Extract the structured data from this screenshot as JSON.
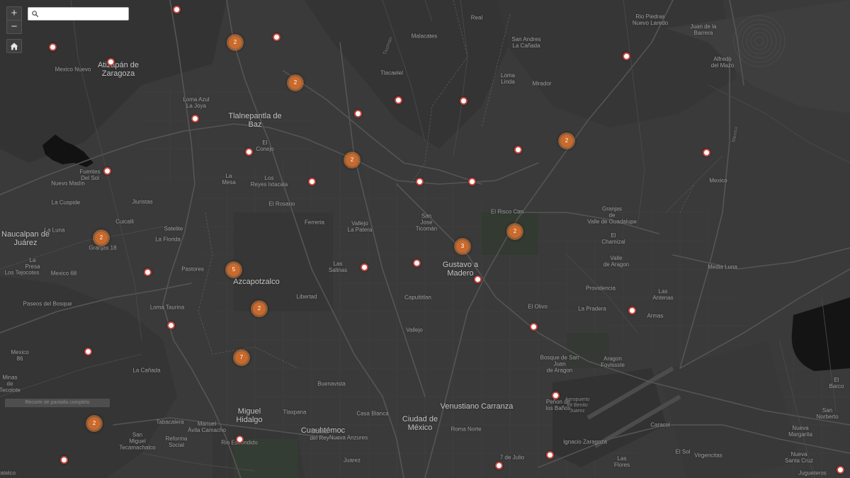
{
  "search": {
    "placeholder": ""
  },
  "zoom": {
    "in_label": "+",
    "out_label": "−"
  },
  "fullscreen_label": "Recorte de pantalla completo",
  "icons": {
    "zoom_in": "plus-icon",
    "zoom_out": "minus-icon",
    "home": "home-icon",
    "search": "search-icon"
  },
  "colors": {
    "basemap": "#3a3a3a",
    "pin_border": "#c9463d",
    "cluster_fill": "#c96a2c"
  },
  "places": [
    {
      "name": "Atizapán de\nZaragoza",
      "cls": "major"
    },
    {
      "name": "Mexico Nuevo",
      "cls": ""
    },
    {
      "name": "Tlalnepantla de\nBaz",
      "cls": "major"
    },
    {
      "name": "Naucalpan de\nJuárez",
      "cls": "major"
    },
    {
      "name": "Azcapotzalco",
      "cls": "major"
    },
    {
      "name": "Gustavo a\nMadero",
      "cls": "major"
    },
    {
      "name": "Miguel\nHidalgo",
      "cls": "major"
    },
    {
      "name": "Ciudad de\nMéxico",
      "cls": "major"
    },
    {
      "name": "Venustiano Carranza",
      "cls": "major"
    },
    {
      "name": "Cuauhtémoc",
      "cls": "major"
    },
    {
      "name": "Loma Azul\nLa Joya",
      "cls": ""
    },
    {
      "name": "El\nConejo",
      "cls": ""
    },
    {
      "name": "La\nMesa",
      "cls": ""
    },
    {
      "name": "Los\nReyes Ixtacala",
      "cls": ""
    },
    {
      "name": "El Rosario",
      "cls": ""
    },
    {
      "name": "Fuentes\nDel Sol",
      "cls": ""
    },
    {
      "name": "Nuevo Madín",
      "cls": ""
    },
    {
      "name": "La Cuspide",
      "cls": ""
    },
    {
      "name": "Jiuristas",
      "cls": ""
    },
    {
      "name": "Cuicalli",
      "cls": ""
    },
    {
      "name": "Satelite",
      "cls": ""
    },
    {
      "name": "La Florida",
      "cls": ""
    },
    {
      "name": "La Luna",
      "cls": ""
    },
    {
      "name": "Granjas 18",
      "cls": ""
    },
    {
      "name": "La\nPresa",
      "cls": ""
    },
    {
      "name": "Los Tejocotes",
      "cls": ""
    },
    {
      "name": "Mexico 68",
      "cls": ""
    },
    {
      "name": "Pastores",
      "cls": ""
    },
    {
      "name": "Paseos del Bosque",
      "cls": ""
    },
    {
      "name": "Loma Taurina",
      "cls": ""
    },
    {
      "name": "Mexico\n86",
      "cls": ""
    },
    {
      "name": "La Cañada",
      "cls": ""
    },
    {
      "name": "Minas\nde\nTecolote",
      "cls": ""
    },
    {
      "name": "Ferreria",
      "cls": ""
    },
    {
      "name": "Vallejo\nLa Patera",
      "cls": ""
    },
    {
      "name": "San\nJose\nTicomán",
      "cls": ""
    },
    {
      "name": "Las\nSalinas",
      "cls": ""
    },
    {
      "name": "Libertad",
      "cls": ""
    },
    {
      "name": "Capultitlan",
      "cls": ""
    },
    {
      "name": "Vallejo",
      "cls": ""
    },
    {
      "name": "Tlacaelel",
      "cls": ""
    },
    {
      "name": "Malacates",
      "cls": ""
    },
    {
      "name": "San Andres\nLa Cañada",
      "cls": ""
    },
    {
      "name": "Loma\nLinda",
      "cls": ""
    },
    {
      "name": "Mirador",
      "cls": ""
    },
    {
      "name": "Rio Piedras\nNuevo Laredo",
      "cls": ""
    },
    {
      "name": "Juan de la\nBarrera",
      "cls": ""
    },
    {
      "name": "Alfredo\ndel Mazo",
      "cls": ""
    },
    {
      "name": "El Risco Ctm",
      "cls": ""
    },
    {
      "name": "Granjas\nde\nValle de Guadalupe",
      "cls": ""
    },
    {
      "name": "El\nChamizal",
      "cls": ""
    },
    {
      "name": "Valle\nde Aragon",
      "cls": ""
    },
    {
      "name": "Providencia",
      "cls": ""
    },
    {
      "name": "Las\nAntenas",
      "cls": ""
    },
    {
      "name": "La Pradera",
      "cls": ""
    },
    {
      "name": "El Olivo",
      "cls": ""
    },
    {
      "name": "Armas",
      "cls": ""
    },
    {
      "name": "Media Luna",
      "cls": ""
    },
    {
      "name": "Mexico",
      "cls": ""
    },
    {
      "name": "Bosque de San\nJuan\nde Aragon",
      "cls": ""
    },
    {
      "name": "Aragon\nFovissste",
      "cls": ""
    },
    {
      "name": "Peñon de\nlos Baños",
      "cls": ""
    },
    {
      "name": "Aeropuerto\nInt Benito\nJuarez",
      "cls": "minor"
    },
    {
      "name": "Buenavista",
      "cls": ""
    },
    {
      "name": "Tlaxpana",
      "cls": ""
    },
    {
      "name": "Casa Blanca",
      "cls": ""
    },
    {
      "name": "Tabacalera",
      "cls": ""
    },
    {
      "name": "Manuel\nÁvila Camacho",
      "cls": ""
    },
    {
      "name": "Reforma\nSocial",
      "cls": ""
    },
    {
      "name": "San\nMiguel\nTecamachalco",
      "cls": ""
    },
    {
      "name": "Rio Escondido",
      "cls": ""
    },
    {
      "name": "Molino\ndel Rey",
      "cls": ""
    },
    {
      "name": "Nueva Anzures",
      "cls": ""
    },
    {
      "name": "Juarez",
      "cls": ""
    },
    {
      "name": "Roma Norte",
      "cls": ""
    },
    {
      "name": "7 de Julio",
      "cls": ""
    },
    {
      "name": "Ignacio Zaragoza",
      "cls": ""
    },
    {
      "name": "Caracol",
      "cls": ""
    },
    {
      "name": "El Sol",
      "cls": ""
    },
    {
      "name": "Virgencitas",
      "cls": ""
    },
    {
      "name": "Las\nFlores",
      "cls": ""
    },
    {
      "name": "El\nBarco",
      "cls": ""
    },
    {
      "name": "San\nNorberto",
      "cls": ""
    },
    {
      "name": "Nueva\nMargarita",
      "cls": ""
    },
    {
      "name": "Nueva\nSanta Cruz",
      "cls": ""
    },
    {
      "name": "Jugueteros",
      "cls": ""
    },
    {
      "name": "Tlatelco",
      "cls": ""
    },
    {
      "name": "Real",
      "cls": ""
    },
    {
      "name": "Ticoman",
      "cls": "road"
    },
    {
      "name": "Mexico",
      "cls": "road"
    },
    {
      "name": "Canal de Sales",
      "cls": "road"
    }
  ],
  "clusters": [
    {
      "count": "2"
    },
    {
      "count": "2"
    },
    {
      "count": "2"
    },
    {
      "count": "2"
    },
    {
      "count": "2"
    },
    {
      "count": "2"
    },
    {
      "count": "3"
    },
    {
      "count": "5"
    },
    {
      "count": "2"
    },
    {
      "count": "7"
    },
    {
      "count": "2"
    }
  ]
}
